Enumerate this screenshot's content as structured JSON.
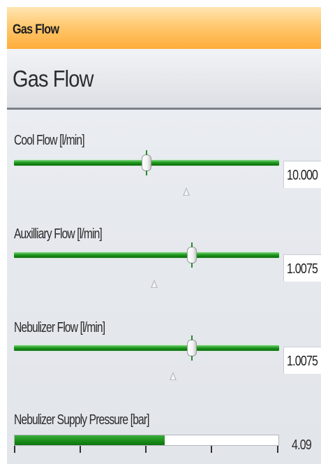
{
  "window": {
    "title": "Gas Flow"
  },
  "panel": {
    "heading": "Gas Flow"
  },
  "controls": [
    {
      "label": "Cool Flow [l/min]",
      "value": "10.000",
      "slider_fraction": 0.5,
      "marker_fraction": 0.65
    },
    {
      "label": "Auxilliary Flow [l/min]",
      "value": "1.0075",
      "slider_fraction": 0.67,
      "marker_fraction": 0.53
    },
    {
      "label": "Nebulizer Flow [l/min]",
      "value": "1.0075",
      "slider_fraction": 0.67,
      "marker_fraction": 0.6
    }
  ],
  "pressure": {
    "label": "Nebulizer Supply Pressure [bar]",
    "value": "4.09",
    "fill_fraction": 0.57
  },
  "colors": {
    "titlebar": "#ffad3a",
    "slider_green": "#1f9a1f",
    "panel_bg": "#e6e9ee"
  }
}
